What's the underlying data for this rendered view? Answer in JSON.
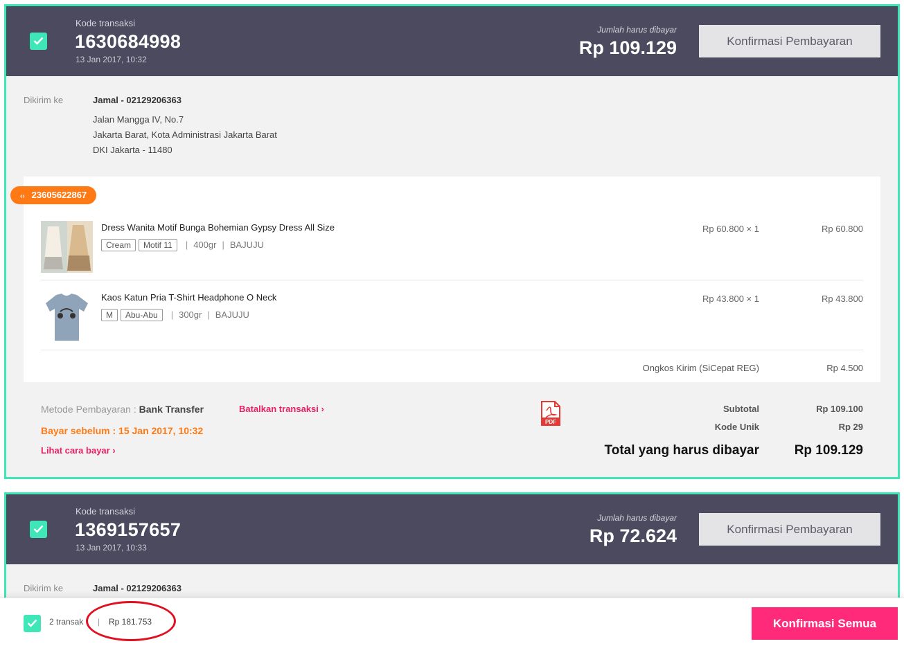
{
  "colors": {
    "accent": "#3ee6b8",
    "header_bg": "#4c4a5e",
    "pink": "#ff2a7a",
    "orange": "#ff7a14"
  },
  "transactions": [
    {
      "code_label": "Kode transaksi",
      "code": "1630684998",
      "date": "13 Jan 2017, 10:32",
      "due_label": "Jumlah harus dibayar",
      "due_amount": "Rp 109.129",
      "confirm_label": "Konfirmasi Pembayaran",
      "shipping": {
        "label": "Dikirim ke",
        "name": "Jamal - 02129206363",
        "address": [
          "Jalan Mangga IV, No.7",
          "Jakarta Barat, Kota Administrasi Jakarta Barat",
          "DKI Jakarta - 11480"
        ]
      },
      "order_id": "23605622867",
      "order_icon": "code-icon",
      "items": [
        {
          "name": "Dress Wanita Motif Bunga Bohemian Gypsy Dress All Size",
          "variants": [
            "Cream",
            "Motif 11"
          ],
          "weight": "400gr",
          "shop": "BAJUJU",
          "unit_price": "Rp 60.800 × 1",
          "total": "Rp 60.800"
        },
        {
          "name": "Kaos Katun Pria T-Shirt Headphone O Neck",
          "variants": [
            "M",
            "Abu-Abu"
          ],
          "weight": "300gr",
          "shop": "BAJUJU",
          "unit_price": "Rp 43.800 × 1",
          "total": "Rp 43.800"
        }
      ],
      "shipping_cost_label": "Ongkos Kirim (SiCepat REG)",
      "shipping_cost": "Rp 4.500",
      "payment_method_label": "Metode Pembayaran :",
      "payment_method": "Bank Transfer",
      "cancel_label": "Batalkan transaksi",
      "pay_before": "Bayar sebelum : 15 Jan 2017, 10:32",
      "how_to_pay_label": "Lihat cara bayar",
      "pdf_icon": "pdf-icon",
      "pdf_label": "PDF",
      "subtotal_label": "Subtotal",
      "subtotal": "Rp 109.100",
      "unique_code_label": "Kode Unik",
      "unique_code": "Rp 29",
      "total_label": "Total yang harus dibayar",
      "total": "Rp 109.129"
    },
    {
      "code_label": "Kode transaksi",
      "code": "1369157657",
      "date": "13 Jan 2017, 10:33",
      "due_label": "Jumlah harus dibayar",
      "due_amount": "Rp 72.624",
      "confirm_label": "Konfirmasi Pembayaran",
      "shipping": {
        "label": "Dikirim ke",
        "name": "Jamal - 02129206363"
      }
    }
  ],
  "footer": {
    "count_text": "2 transak",
    "separator": "|",
    "total": "Rp 181.753",
    "confirm_all_label": "Konfirmasi Semua"
  }
}
